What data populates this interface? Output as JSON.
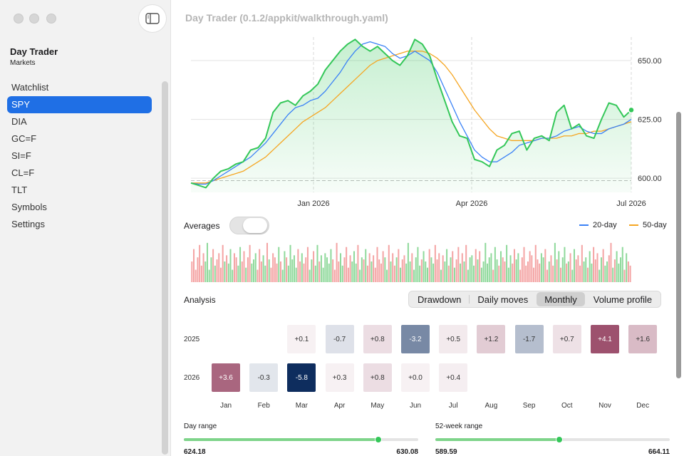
{
  "window": {
    "title": "Day Trader (0.1.2/appkit/walkthrough.yaml)"
  },
  "sidebar": {
    "app_title": "Day Trader",
    "app_subtitle": "Markets",
    "items": [
      {
        "label": "Watchlist",
        "active": false
      },
      {
        "label": "SPY",
        "active": true
      },
      {
        "label": "DIA",
        "active": false
      },
      {
        "label": "GC=F",
        "active": false
      },
      {
        "label": "SI=F",
        "active": false
      },
      {
        "label": "CL=F",
        "active": false
      },
      {
        "label": "TLT",
        "active": false
      },
      {
        "label": "Symbols",
        "active": false
      },
      {
        "label": "Settings",
        "active": false
      }
    ]
  },
  "chart_data": {
    "type": "line",
    "title": "",
    "x_ticks": [
      "Jan 2026",
      "Apr 2026",
      "Jul 2026"
    ],
    "y_ticks": [
      "650.00",
      "625.00",
      "600.00"
    ],
    "ylim": [
      594,
      660
    ],
    "reference_line": 599,
    "series": [
      {
        "name": "",
        "color": "#34c759",
        "values": [
          598,
          597,
          596,
          600,
          603,
          604,
          606,
          607,
          612,
          613,
          617,
          628,
          632,
          633,
          631,
          635,
          637,
          640,
          646,
          650,
          654,
          657,
          659,
          656,
          654,
          656,
          653,
          650,
          648,
          652,
          659,
          657,
          652,
          642,
          633,
          624,
          618,
          617,
          608,
          607,
          605,
          612,
          614,
          619,
          620,
          612,
          617,
          618,
          616,
          628,
          631,
          621,
          623,
          618,
          617,
          625,
          632,
          631,
          626,
          629
        ]
      },
      {
        "name": "20-day",
        "color": "#3b82f6",
        "values": [
          598,
          597.5,
          597.5,
          599,
          601,
          603,
          605,
          607,
          609,
          612,
          615,
          619,
          623,
          627,
          630,
          631,
          633,
          634,
          637,
          641,
          645,
          650,
          654,
          657,
          658,
          657,
          656,
          653,
          651,
          652,
          654,
          652,
          650,
          645,
          638,
          631,
          624,
          618,
          612,
          609,
          607,
          607,
          609,
          611,
          614,
          615,
          616,
          617,
          617,
          618,
          620,
          621,
          622,
          620,
          619,
          619,
          621,
          622,
          623,
          625
        ]
      },
      {
        "name": "50-day",
        "color": "#f5a623",
        "values": [
          598,
          598,
          598,
          599,
          600,
          601,
          602,
          603,
          605,
          607,
          609,
          612,
          615,
          618,
          621,
          624,
          626,
          628,
          630,
          633,
          636,
          639,
          642,
          645,
          648,
          650,
          651,
          652,
          653,
          654,
          654,
          654,
          653,
          651,
          648,
          644,
          639,
          634,
          629,
          625,
          621,
          618,
          617,
          616,
          616,
          616,
          616,
          617,
          617,
          617,
          618,
          618,
          619,
          619,
          620,
          620,
          621,
          622,
          623,
          624
        ]
      }
    ],
    "volume": {
      "colors": {
        "up": "#8fd99b",
        "down": "#f4a4a4"
      },
      "values": [
        0.5,
        0.8,
        0.3,
        0.6,
        0.9,
        0.4,
        0.7,
        0.5,
        0.95,
        0.3,
        0.6,
        0.8,
        0.4,
        0.55,
        0.7,
        0.35,
        0.9,
        0.5,
        0.65,
        0.45,
        0.8,
        0.3,
        0.7,
        0.6,
        0.4,
        0.85,
        0.5,
        0.75,
        0.35,
        0.6,
        0.9,
        0.45,
        0.55,
        0.7,
        0.3,
        0.8,
        0.5,
        0.65,
        0.4,
        0.95,
        0.55,
        0.35,
        0.7,
        0.6,
        0.45,
        0.85,
        0.5,
        0.3,
        0.75,
        0.6,
        0.4,
        0.9,
        0.55,
        0.65,
        0.35,
        0.8,
        0.5,
        0.7,
        0.45,
        0.6,
        0.85,
        0.3,
        0.55,
        0.75,
        0.4,
        0.9,
        0.5,
        0.65,
        0.35,
        0.7,
        0.6,
        0.45,
        0.8,
        0.55,
        0.3,
        0.95,
        0.5,
        0.7,
        0.4,
        0.6,
        0.85,
        0.35,
        0.65,
        0.5,
        0.75,
        0.45,
        0.9,
        0.3,
        0.6,
        0.55,
        0.8,
        0.4,
        0.7,
        0.5,
        0.65,
        0.35,
        0.85,
        0.55,
        0.45,
        0.75,
        0.6,
        0.3,
        0.9,
        0.5,
        0.7,
        0.4,
        0.6,
        0.8,
        0.35,
        0.55,
        0.65,
        0.45,
        0.95,
        0.5,
        0.7,
        0.3,
        0.6,
        0.85,
        0.4,
        0.55,
        0.75,
        0.5,
        0.35,
        0.8,
        0.6,
        0.45,
        0.9,
        0.55,
        0.7,
        0.3,
        0.65,
        0.5,
        0.8,
        0.4,
        0.6,
        0.75,
        0.35,
        0.55,
        0.85,
        0.45,
        0.7,
        0.5,
        0.9,
        0.3,
        0.6,
        0.65,
        0.4,
        0.8,
        0.55,
        0.75,
        0.35,
        0.5,
        0.95,
        0.45,
        0.6,
        0.7,
        0.3,
        0.85,
        0.55,
        0.4,
        0.75,
        0.6,
        0.5,
        0.9,
        0.35,
        0.65,
        0.45,
        0.8,
        0.55,
        0.7,
        0.3,
        0.6,
        0.85,
        0.4,
        0.5,
        0.75,
        0.65,
        0.35,
        0.9,
        0.55,
        0.45,
        0.7,
        0.6,
        0.8,
        0.3,
        0.5,
        0.65,
        0.4,
        0.95,
        0.55,
        0.75,
        0.35,
        0.6,
        0.85,
        0.45,
        0.5,
        0.7,
        0.3,
        0.8,
        0.55,
        0.65,
        0.4,
        0.9,
        0.5,
        0.6,
        0.35,
        0.75,
        0.45,
        0.85,
        0.55,
        0.7,
        0.3,
        0.6,
        0.8,
        0.4,
        0.5,
        0.65,
        0.95,
        0.35,
        0.55,
        0.75,
        0.45,
        0.6,
        0.85,
        0.3,
        0.7,
        0.5,
        0.4
      ]
    }
  },
  "legend": [
    {
      "label": "20-day",
      "color": "#3b82f6"
    },
    {
      "label": "50-day",
      "color": "#f5a623"
    }
  ],
  "averages": {
    "label": "Averages",
    "on": false
  },
  "analysis": {
    "label": "Analysis",
    "tabs": [
      {
        "label": "Drawdown",
        "active": false
      },
      {
        "label": "Daily moves",
        "active": false
      },
      {
        "label": "Monthly",
        "active": true
      },
      {
        "label": "Volume profile",
        "active": false
      }
    ],
    "years": [
      "2025",
      "2026"
    ],
    "months": [
      "Jan",
      "Feb",
      "Mar",
      "Apr",
      "May",
      "Jun",
      "Jul",
      "Aug",
      "Sep",
      "Oct",
      "Nov",
      "Dec"
    ],
    "monthly_returns": {
      "2025": [
        null,
        null,
        "+0.1",
        "-0.7",
        "+0.8",
        "-3.2",
        "+0.5",
        "+1.2",
        "-1.7",
        "+0.7",
        "+4.1",
        "+1.6"
      ],
      "2026": [
        "+3.6",
        "-0.3",
        "-5.8",
        "+0.3",
        "+0.8",
        "+0.0",
        "+0.4",
        null,
        null,
        null,
        null,
        null
      ]
    },
    "colors": {
      "positive": "#9b4d6a",
      "negative": "#0e2d5e"
    }
  },
  "ranges": [
    {
      "label": "Day range",
      "low": "624.18",
      "high": "630.08",
      "position": 0.83
    },
    {
      "label": "52-week range",
      "low": "589.59",
      "high": "664.11",
      "position": 0.53
    }
  ]
}
